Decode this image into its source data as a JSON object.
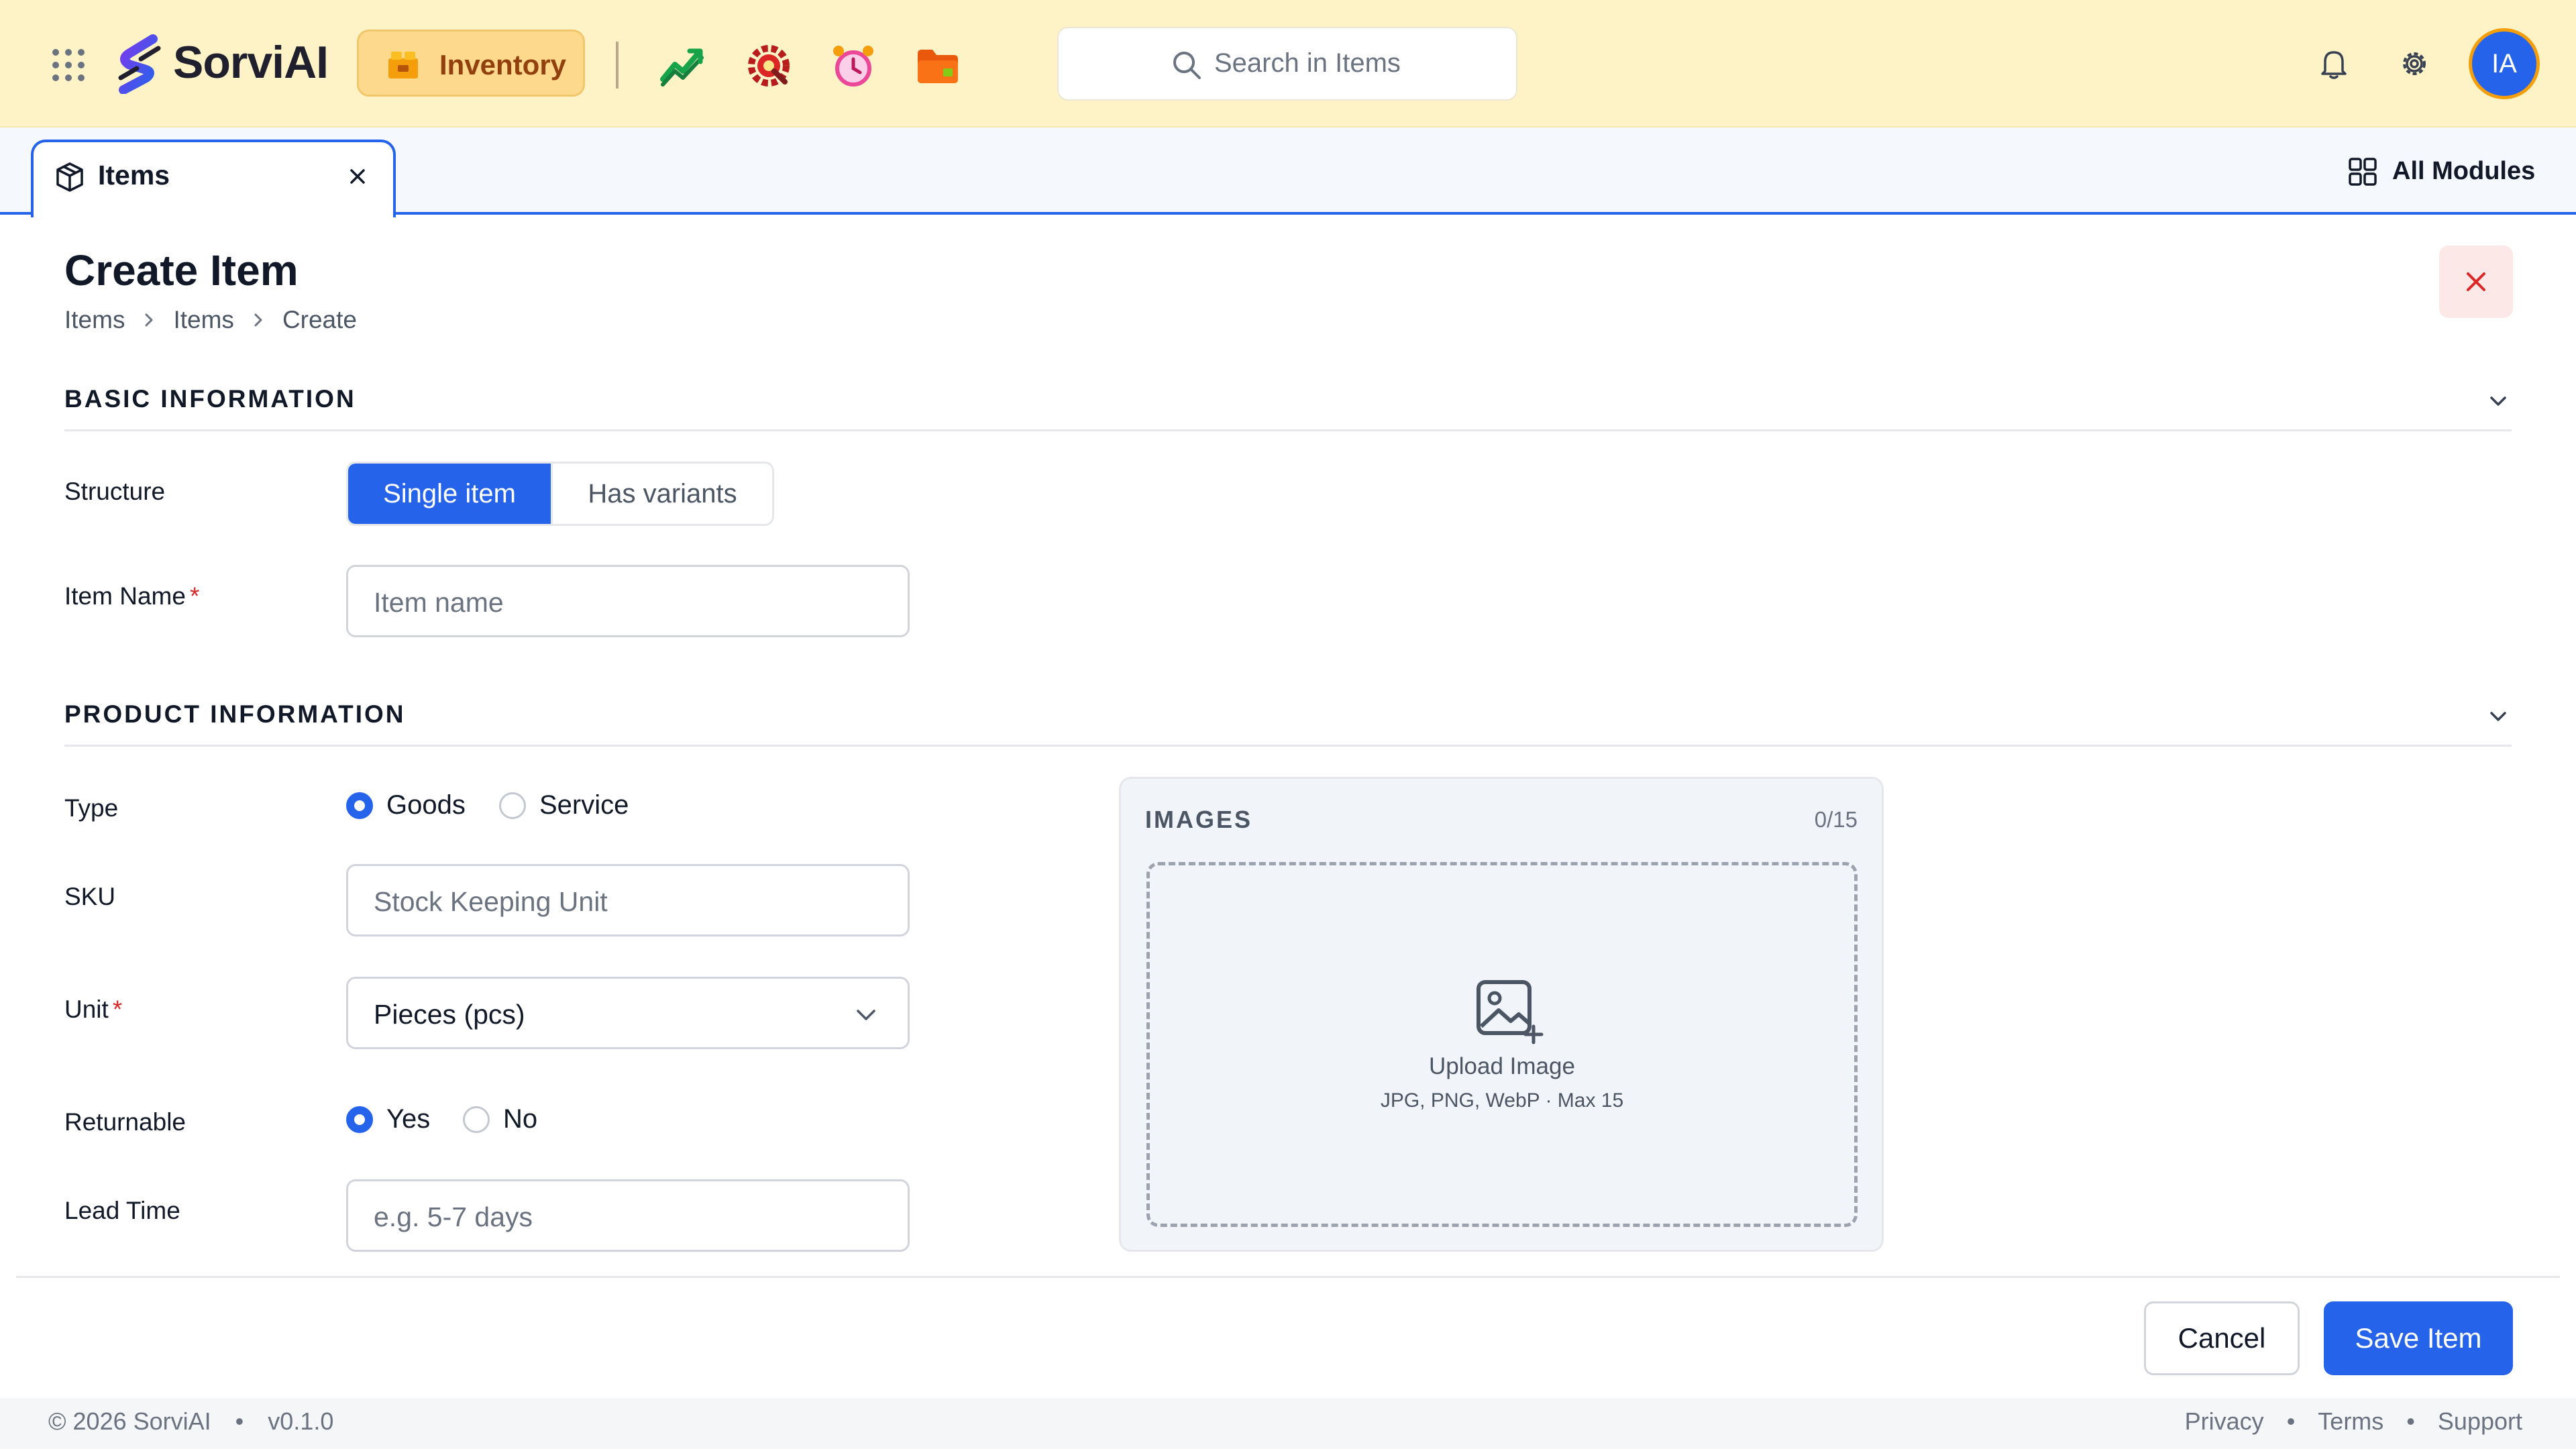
{
  "header": {
    "app_name": "SorviAI",
    "active_module": "Inventory",
    "search_placeholder": "Search in Items",
    "avatar_initials": "IA",
    "app_icons": [
      "trend-chart-icon",
      "gear-wrench-icon",
      "alarm-clock-icon",
      "folder-icon"
    ]
  },
  "tabs": [
    {
      "label": "Items",
      "icon": "package-icon",
      "active": true
    }
  ],
  "tabbar": {
    "all_modules_label": "All Modules"
  },
  "page": {
    "title": "Create Item",
    "breadcrumbs": [
      "Items",
      "Items",
      "Create"
    ]
  },
  "sections": {
    "basic": "BASIC INFORMATION",
    "product": "PRODUCT INFORMATION"
  },
  "basic": {
    "structure_label": "Structure",
    "structure_options": [
      "Single item",
      "Has variants"
    ],
    "structure_selected": "Single item",
    "item_name_label": "Item Name",
    "required_mark": "*",
    "item_name_placeholder": "Item name"
  },
  "product": {
    "type_label": "Type",
    "type_options": [
      "Goods",
      "Service"
    ],
    "type_selected": "Goods",
    "sku_label": "SKU",
    "sku_placeholder": "Stock Keeping Unit",
    "unit_label": "Unit",
    "unit_value": "Pieces (pcs)",
    "returnable_label": "Returnable",
    "returnable_options": [
      "Yes",
      "No"
    ],
    "returnable_selected": "Yes",
    "lead_time_label": "Lead Time",
    "lead_time_placeholder": "e.g. 5-7 days"
  },
  "images": {
    "label": "IMAGES",
    "count": "0/15",
    "upload_text": "Upload Image",
    "hint": "JPG, PNG, WebP · Max 15"
  },
  "actions": {
    "cancel": "Cancel",
    "save": "Save Item"
  },
  "footer": {
    "copyright": "© 2026 SorviAI",
    "version": "v0.1.0",
    "links": [
      "Privacy",
      "Terms",
      "Support"
    ]
  },
  "colors": {
    "header_bg": "#fef3c7",
    "accent": "#2563eb",
    "required": "#dc2626",
    "module_chip": "#fcd98c"
  }
}
